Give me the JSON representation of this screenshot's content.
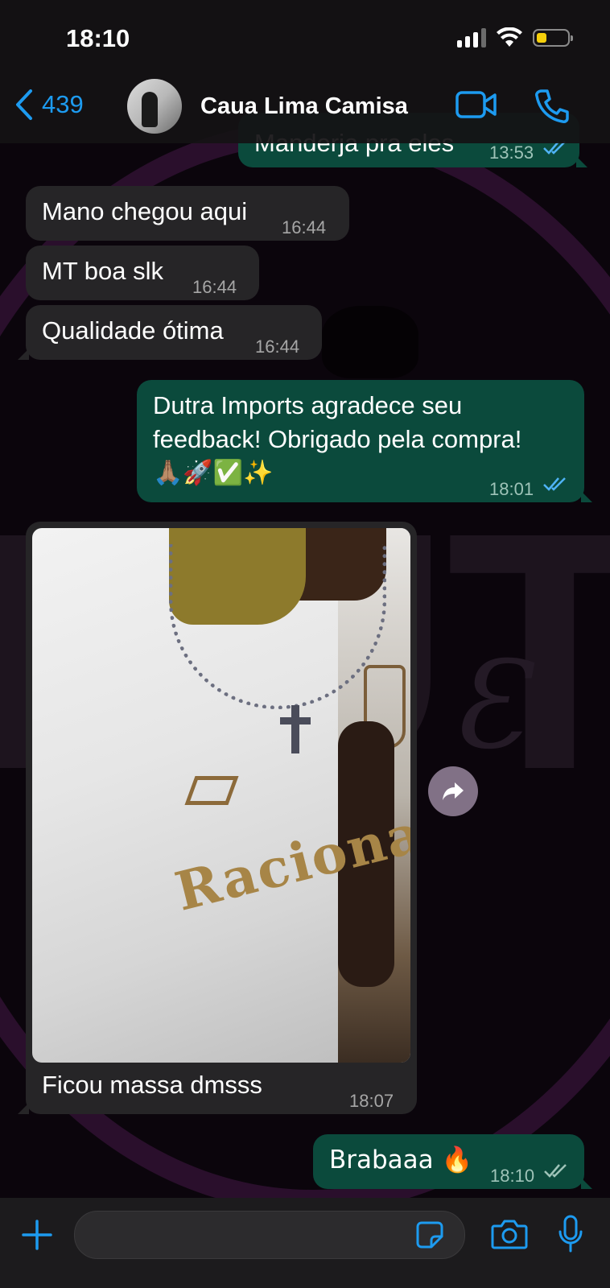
{
  "status_bar": {
    "time": "18:10"
  },
  "header": {
    "back_count": "439",
    "contact_name": "Caua Lima Camisa"
  },
  "messages": [
    {
      "direction": "outgoing",
      "text": "Manderja pra eles",
      "time": "13:53",
      "read": true
    },
    {
      "direction": "incoming",
      "text": "Mano chegou aqui",
      "time": "16:44"
    },
    {
      "direction": "incoming",
      "text": "MT boa slk",
      "time": "16:44"
    },
    {
      "direction": "incoming",
      "text": "Qualidade ótima",
      "time": "16:44"
    },
    {
      "direction": "outgoing",
      "line1": "Dutra Imports agradece seu",
      "line2": "feedback! Obrigado pela compra!",
      "line3": "🙏🏽🚀✅✨",
      "time": "18:01",
      "read": true
    },
    {
      "direction": "incoming",
      "type": "image",
      "shirt_text": "Raciona",
      "caption": "Ficou massa dmsss",
      "time": "18:07"
    },
    {
      "direction": "outgoing",
      "text": "Brabaaa 🔥",
      "time": "18:10",
      "read": false
    }
  ],
  "wallpaper": {
    "letters": "DUTRA"
  },
  "input_bar": {
    "placeholder": ""
  },
  "colors": {
    "accent": "#1d9bf0",
    "incoming_bubble": "#262527",
    "outgoing_bubble": "#0b4a3c",
    "read_tick": "#4fb3f6",
    "unread_tick": "#9ec3b8"
  }
}
